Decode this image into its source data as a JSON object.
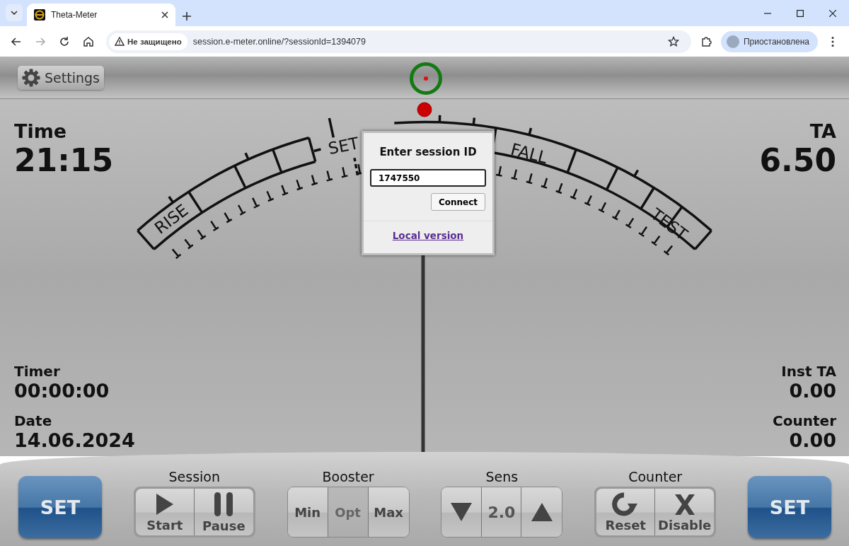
{
  "browser": {
    "tab_title": "Theta-Meter",
    "security_label": "Не защищено",
    "url": "session.e-meter.online/?sessionId=1394079",
    "profile_label": "Приостановлена"
  },
  "toolbar": {
    "settings_label": "Settings"
  },
  "dial": {
    "labels": [
      "RISE",
      "SET",
      "FALL",
      "TEST"
    ]
  },
  "readouts": {
    "time": {
      "label": "Time",
      "value": "21:15"
    },
    "ta": {
      "label": "TA",
      "value": "6.50"
    },
    "timer": {
      "label": "Timer",
      "value": "00:00:00"
    },
    "date": {
      "label": "Date",
      "value": "14.06.2024"
    },
    "inst_ta": {
      "label": "Inst TA",
      "value": "0.00"
    },
    "counter": {
      "label": "Counter",
      "value": "0.00"
    }
  },
  "dialog": {
    "title": "Enter session ID",
    "input_value": "1747550",
    "connect_label": "Connect",
    "link_label": "Local version"
  },
  "controls": {
    "set_left": "SET",
    "set_right": "SET",
    "groups": [
      {
        "kind": "session",
        "title": "Session",
        "buttons": [
          {
            "label": "Start"
          },
          {
            "label": "Pause"
          }
        ]
      },
      {
        "kind": "booster",
        "title": "Booster",
        "options": [
          {
            "label": "Min",
            "selected": false
          },
          {
            "label": "Opt",
            "selected": true
          },
          {
            "label": "Max",
            "selected": false
          }
        ]
      },
      {
        "kind": "sens",
        "title": "Sens",
        "value": "2.0"
      },
      {
        "kind": "counter",
        "title": "Counter",
        "buttons": [
          {
            "label": "Reset"
          },
          {
            "label": "Disable"
          }
        ]
      }
    ]
  }
}
